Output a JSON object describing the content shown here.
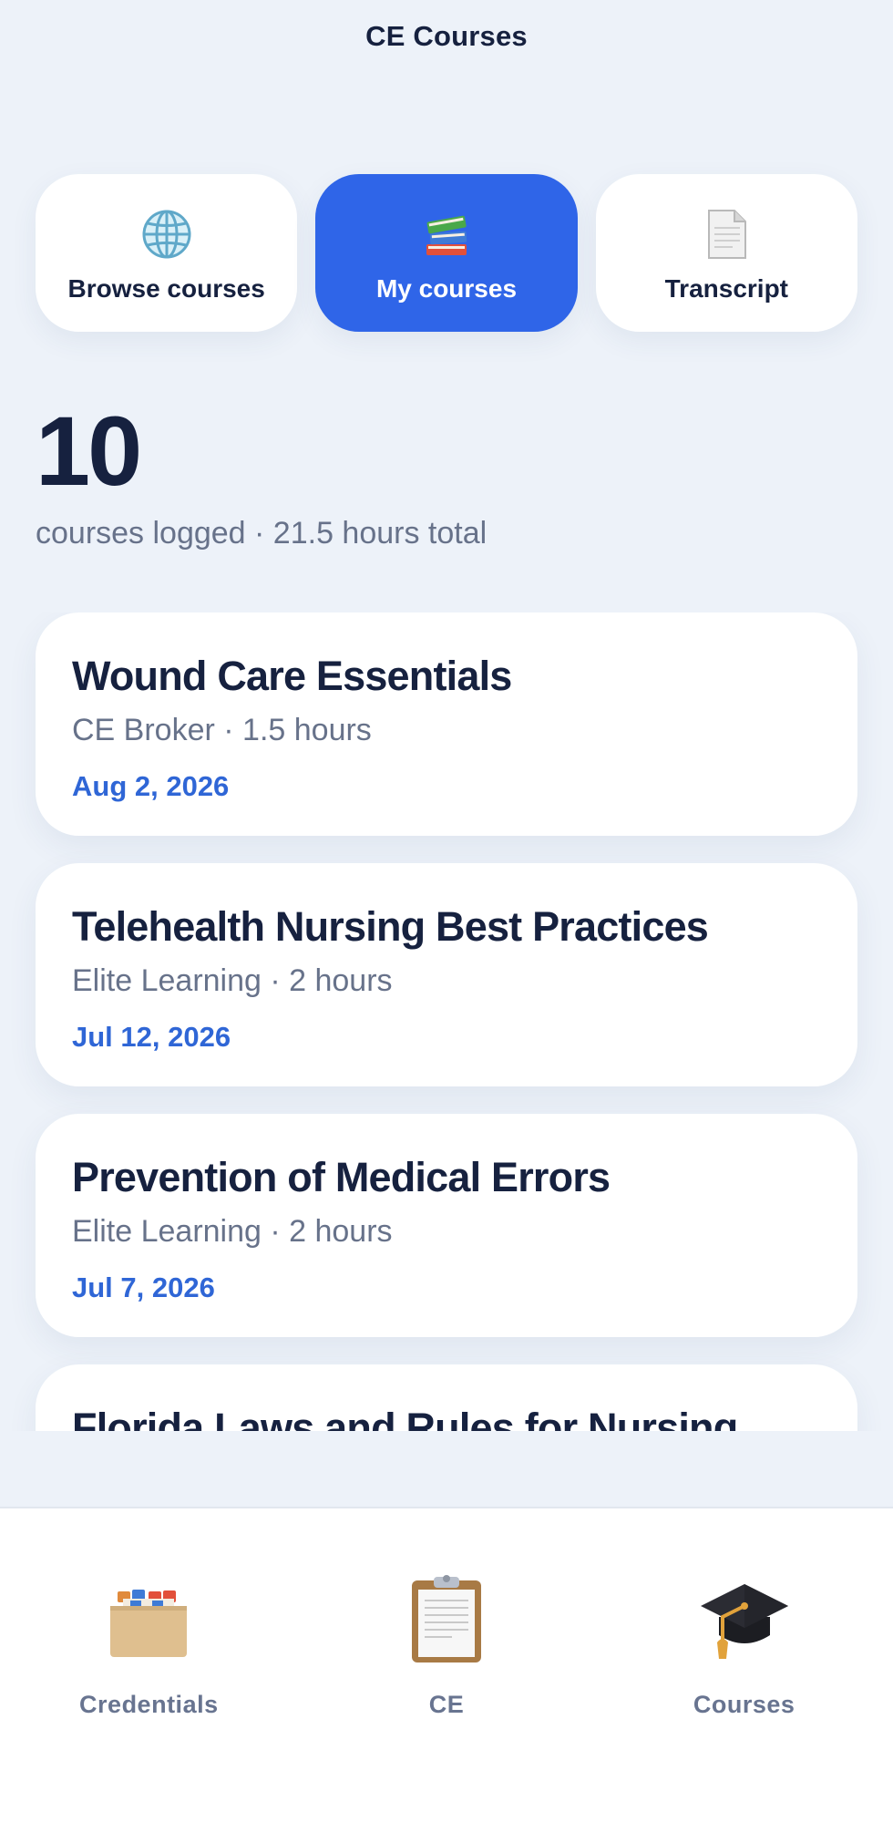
{
  "header": {
    "title": "CE Courses"
  },
  "segments": [
    {
      "label": "Browse courses",
      "icon": "globe-icon",
      "active": false
    },
    {
      "label": "My courses",
      "icon": "books-icon",
      "active": true
    },
    {
      "label": "Transcript",
      "icon": "document-icon",
      "active": false
    }
  ],
  "stats": {
    "count": "10",
    "summary": "courses logged · 21.5 hours total"
  },
  "courses": [
    {
      "title": "Wound Care Essentials",
      "meta": "CE Broker · 1.5 hours",
      "date": "Aug 2, 2026"
    },
    {
      "title": "Telehealth Nursing Best Practices",
      "meta": "Elite Learning · 2 hours",
      "date": "Jul 12, 2026"
    },
    {
      "title": "Prevention of Medical Errors",
      "meta": "Elite Learning · 2 hours",
      "date": "Jul 7, 2026"
    },
    {
      "title": "Florida Laws and Rules for Nursing"
    }
  ],
  "tabbar": {
    "tabs": [
      {
        "label": "Credentials",
        "icon": "card-file-box-icon"
      },
      {
        "label": "CE",
        "icon": "clipboard-icon"
      },
      {
        "label": "Courses",
        "icon": "graduation-cap-icon"
      }
    ]
  },
  "colors": {
    "accent": "#2f65e8",
    "date_text": "#2f66d6",
    "background": "#edf2f9",
    "primary_text": "#16213f",
    "secondary_text": "#67728a"
  }
}
